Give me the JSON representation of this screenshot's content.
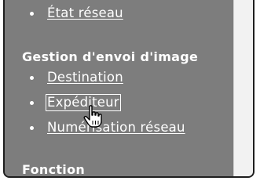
{
  "nav": {
    "top_link": "État réseau",
    "sections": [
      {
        "heading": "Gestion d'envoi d'image",
        "items": [
          {
            "label": "Destination"
          },
          {
            "label": "Expéditeur"
          },
          {
            "label": "Numérisation réseau"
          }
        ]
      },
      {
        "heading": "Fonction"
      }
    ]
  },
  "cursor": {
    "icon": "hand-pointer-icon"
  },
  "colors": {
    "panel_bg": "#7d7d7d",
    "text": "#ffffff",
    "scrollbar": "#f2f2f2"
  }
}
